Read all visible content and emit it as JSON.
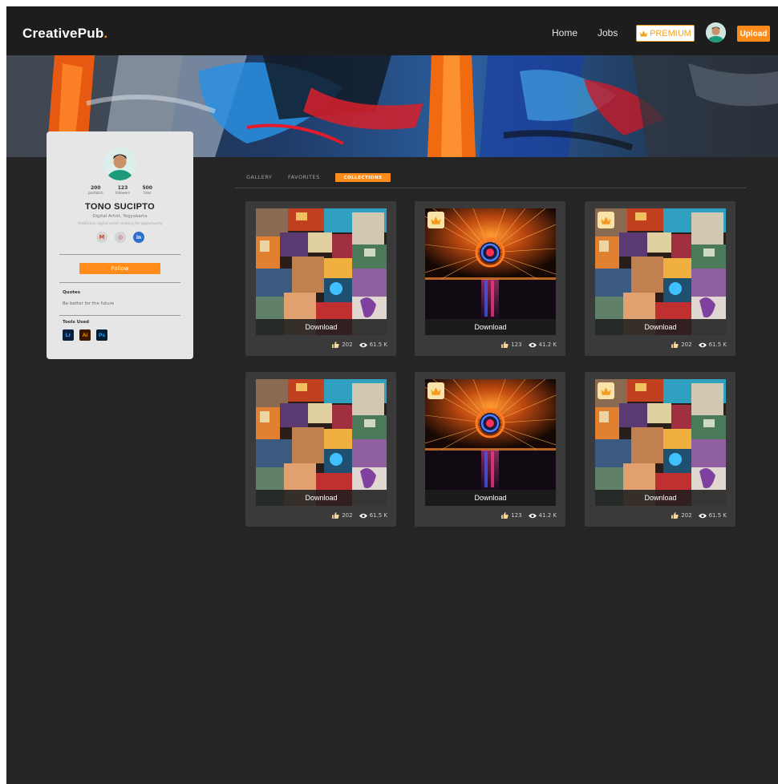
{
  "header": {
    "logo_text": "CreativePub",
    "logo_dot": ".",
    "nav": [
      {
        "label": "Home"
      },
      {
        "label": "Jobs"
      }
    ],
    "premium_label": "PREMIUM",
    "upload_label": "Upload"
  },
  "profile": {
    "name": "TONO SUCIPTO",
    "role": "Digital Artist, Yogyakarta",
    "bio": "Ambitious digital artist seeking for opportunity",
    "stats": [
      {
        "value": "200",
        "label": "postlatch"
      },
      {
        "value": "123",
        "label": "followers"
      },
      {
        "value": "500",
        "label": "likes"
      }
    ],
    "follow_label": "Follow",
    "quotes_title": "Quotes",
    "quotes_text": "Be better for the future",
    "tools_title": "Tools Used",
    "tools": [
      "Lr",
      "Ai",
      "Ps"
    ]
  },
  "tabs": [
    {
      "label": "GALLERY",
      "active": false
    },
    {
      "label": "FAVORITES",
      "active": false
    },
    {
      "label": "COLLECTIONS",
      "active": true
    }
  ],
  "cards": [
    {
      "image": "collage",
      "premium": false,
      "download_label": "Download",
      "likes": "202",
      "views": "61.5 K"
    },
    {
      "image": "steelwool",
      "premium": true,
      "download_label": "Download",
      "likes": "123",
      "views": "41.2 K"
    },
    {
      "image": "collage",
      "premium": true,
      "download_label": "Download",
      "likes": "202",
      "views": "61.5 K"
    },
    {
      "image": "collage",
      "premium": false,
      "download_label": "Download",
      "likes": "202",
      "views": "61.5 K"
    },
    {
      "image": "steelwool",
      "premium": true,
      "download_label": "Download",
      "likes": "123",
      "views": "41.2 K"
    },
    {
      "image": "collage",
      "premium": true,
      "download_label": "Download",
      "likes": "202",
      "views": "61.5 K"
    }
  ],
  "colors": {
    "accent": "#ff8c1a",
    "background": "#252525",
    "header": "#1d1d1d",
    "card": "#3a3a3a"
  }
}
